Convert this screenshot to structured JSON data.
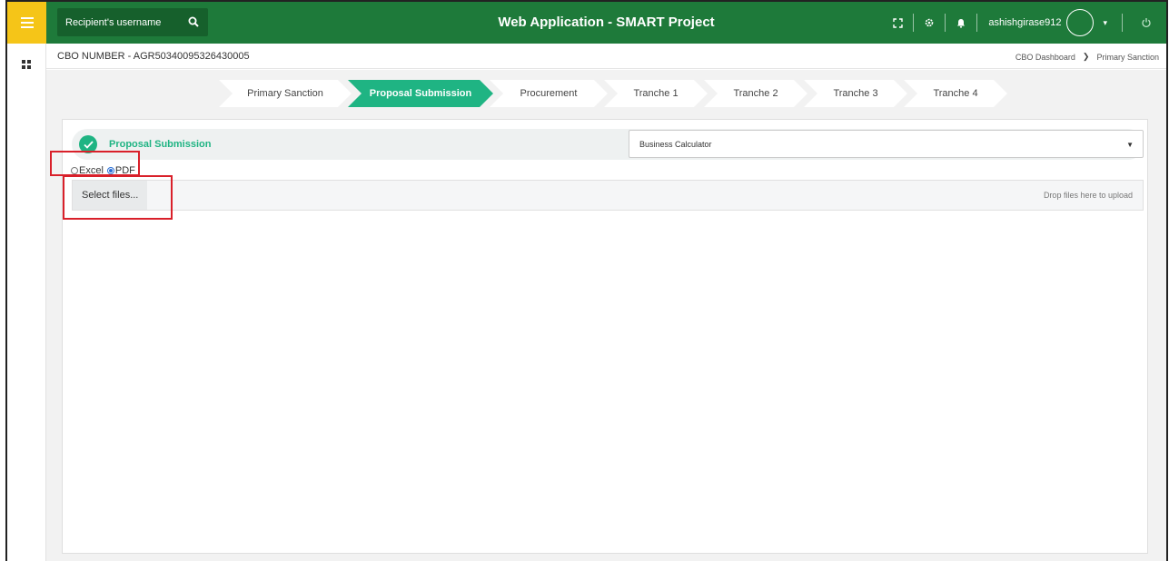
{
  "app": {
    "title": "Web Application - SMART Project",
    "username": "ashishgirase912"
  },
  "search": {
    "placeholder": "Recipient's username"
  },
  "icons": {
    "menu": "hamburger-icon",
    "apps": "grid-icon",
    "search": "search-icon",
    "fullscreen": "fullscreen-icon",
    "settings": "gear-icon",
    "notifications": "bell-icon",
    "user_menu": "chevron-down-icon",
    "logout": "power-icon",
    "completed": "check-icon"
  },
  "subheader": {
    "cbo_number": "CBO NUMBER - AGR50340095326430005",
    "breadcrumb": [
      "CBO Dashboard",
      "Primary Sanction"
    ]
  },
  "steps": [
    {
      "label": "Primary Sanction",
      "active": false
    },
    {
      "label": "Proposal Submission",
      "active": true
    },
    {
      "label": "Procurement",
      "active": false
    },
    {
      "label": "Tranche 1",
      "active": false
    },
    {
      "label": "Tranche 2",
      "active": false
    },
    {
      "label": "Tranche 3",
      "active": false
    },
    {
      "label": "Tranche 4",
      "active": false
    }
  ],
  "section": {
    "title": "Proposal Submission",
    "dropdown_value": "Business Calculator"
  },
  "format": {
    "options": [
      "Excel",
      "PDF"
    ],
    "selected": "PDF"
  },
  "upload": {
    "button_label": "Select files...",
    "drop_hint": "Drop files here to upload"
  },
  "colors": {
    "topbar": "#1e7a3a",
    "menu_button": "#f5c518",
    "accent": "#1fb483",
    "highlight": "#d9202a"
  }
}
